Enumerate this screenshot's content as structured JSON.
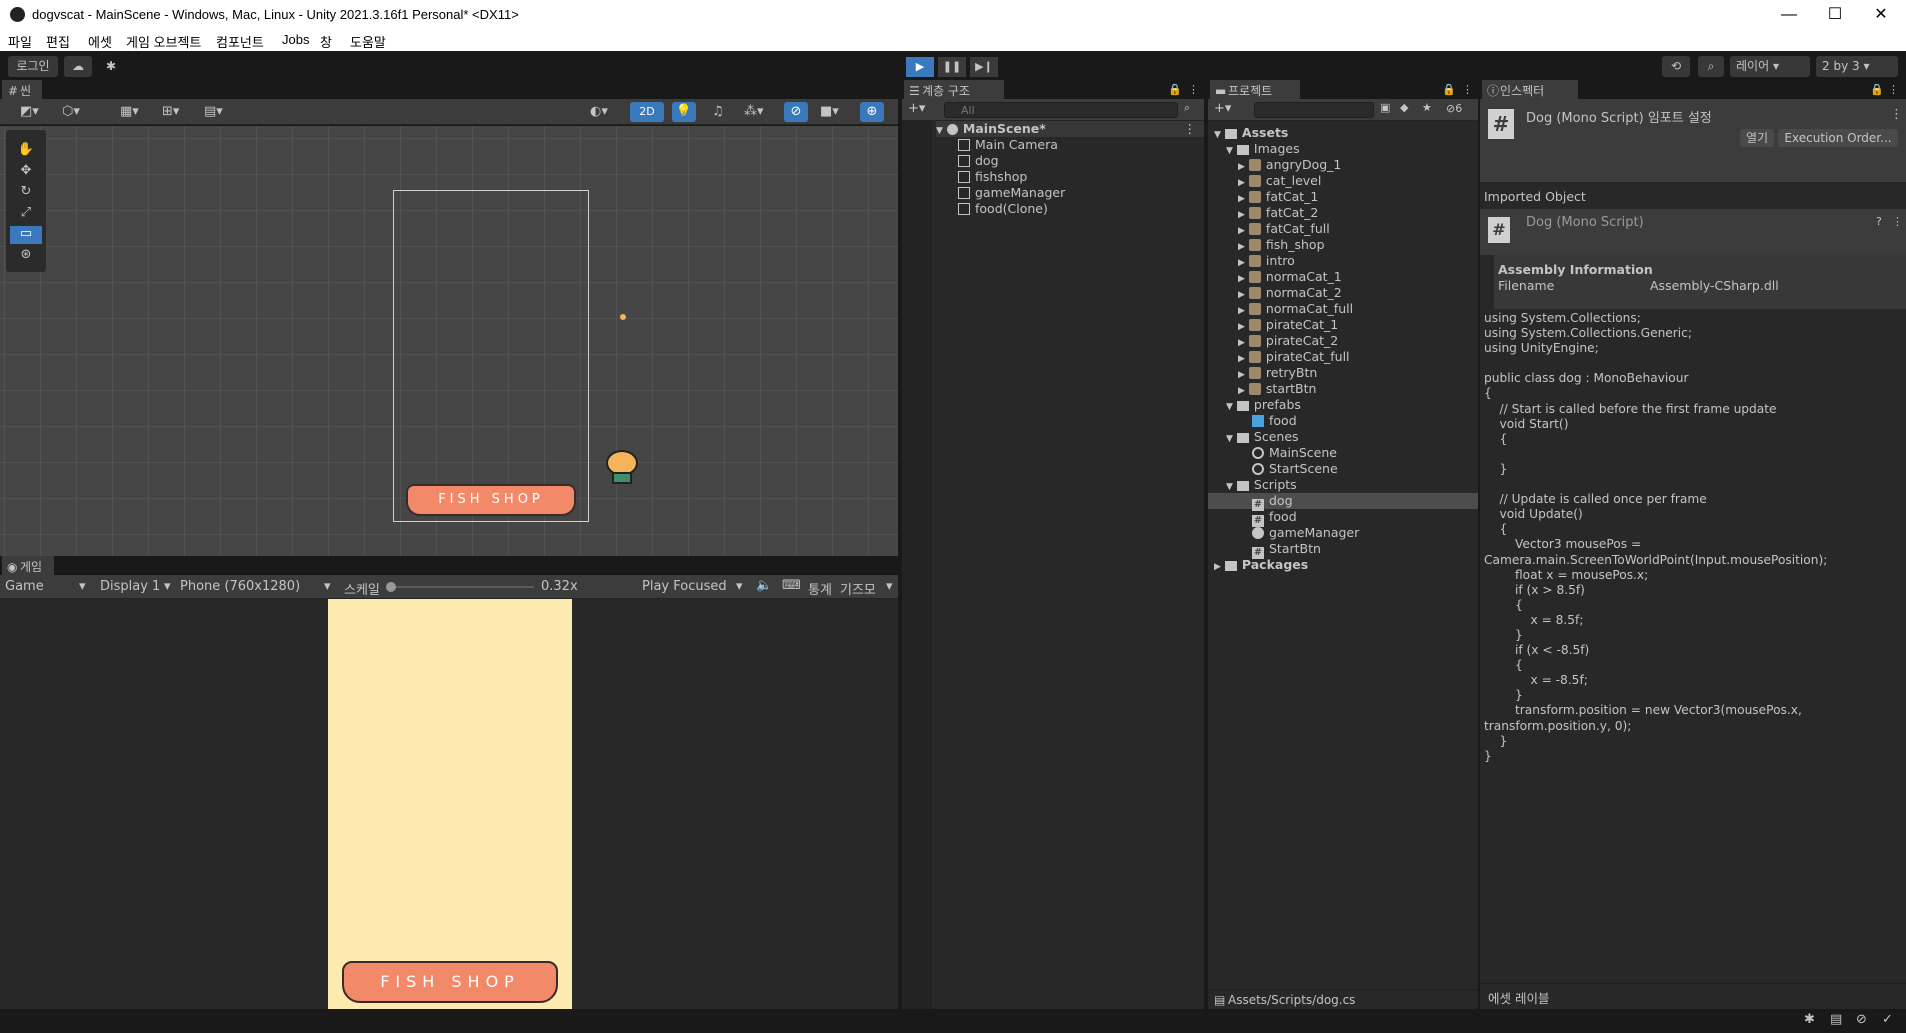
{
  "window": {
    "title": "dogvscat - MainScene - Windows, Mac, Linux - Unity 2021.3.16f1 Personal* <DX11>",
    "min": "—",
    "max": "☐",
    "close": "✕"
  },
  "menu": [
    "파일",
    "편집",
    "에셋",
    "게임 오브젝트",
    "컴포넌트",
    "Jobs",
    "창",
    "도움말"
  ],
  "toolbar": {
    "login": "로그인",
    "layers": "레이어",
    "layout": "2 by 3"
  },
  "scene": {
    "tab": "씬",
    "mode_2d": "2D",
    "sign_text": "FISH SHOP"
  },
  "game": {
    "tab": "게임",
    "view": "Game",
    "display": "Display 1",
    "resolution": "Phone (760x1280)",
    "scale_label": "스케일",
    "scale_value": "0.32x",
    "play_focused": "Play Focused",
    "stats": "통계",
    "gizmos": "기즈모",
    "sign_text": "FISH SHOP"
  },
  "hierarchy": {
    "tab": "계층 구조",
    "search_placeholder": "All",
    "scene": "MainScene*",
    "items": [
      "Main Camera",
      "dog",
      "fishshop",
      "gameManager",
      "food(Clone)"
    ]
  },
  "project": {
    "tab": "프로젝트",
    "hidden_count": "6",
    "root": "Assets",
    "images_folder": "Images",
    "images": [
      "angryDog_1",
      "cat_level",
      "fatCat_1",
      "fatCat_2",
      "fatCat_full",
      "fish_shop",
      "intro",
      "normaCat_1",
      "normaCat_2",
      "normaCat_full",
      "pirateCat_1",
      "pirateCat_2",
      "pirateCat_full",
      "retryBtn",
      "startBtn"
    ],
    "prefabs_folder": "prefabs",
    "prefabs": [
      "food"
    ],
    "scenes_folder": "Scenes",
    "scenes": [
      "MainScene",
      "StartScene"
    ],
    "scripts_folder": "Scripts",
    "scripts": [
      "dog",
      "food",
      "gameManager",
      "StartBtn"
    ],
    "packages": "Packages",
    "path": "Assets/Scripts/dog.cs"
  },
  "inspector": {
    "tab": "인스펙터",
    "title": "Dog (Mono Script) 임포트 설정",
    "open": "열기",
    "exec_order": "Execution Order...",
    "imported_object": "Imported Object",
    "object_name": "Dog (Mono Script)",
    "assembly_header": "Assembly Information",
    "filename_label": "Filename",
    "filename_value": "Assembly-CSharp.dll",
    "code": "using System.Collections;\nusing System.Collections.Generic;\nusing UnityEngine;\n\npublic class dog : MonoBehaviour\n{\n    // Start is called before the first frame update\n    void Start()\n    {\n\n    }\n\n    // Update is called once per frame\n    void Update()\n    {\n        Vector3 mousePos =\nCamera.main.ScreenToWorldPoint(Input.mousePosition);\n        float x = mousePos.x;\n        if (x > 8.5f)\n        {\n            x = 8.5f;\n        }\n        if (x < -8.5f)\n        {\n            x = -8.5f;\n        }\n        transform.position = new Vector3(mousePos.x,\ntransform.position.y, 0);\n    }\n}",
    "asset_labels": "에셋 레이블"
  },
  "colors": {
    "accent": "#3a79bb",
    "sign": "#f28a6a",
    "game_bg": "#fdeaae",
    "panel": "#282828",
    "header": "#3c3c3c"
  }
}
